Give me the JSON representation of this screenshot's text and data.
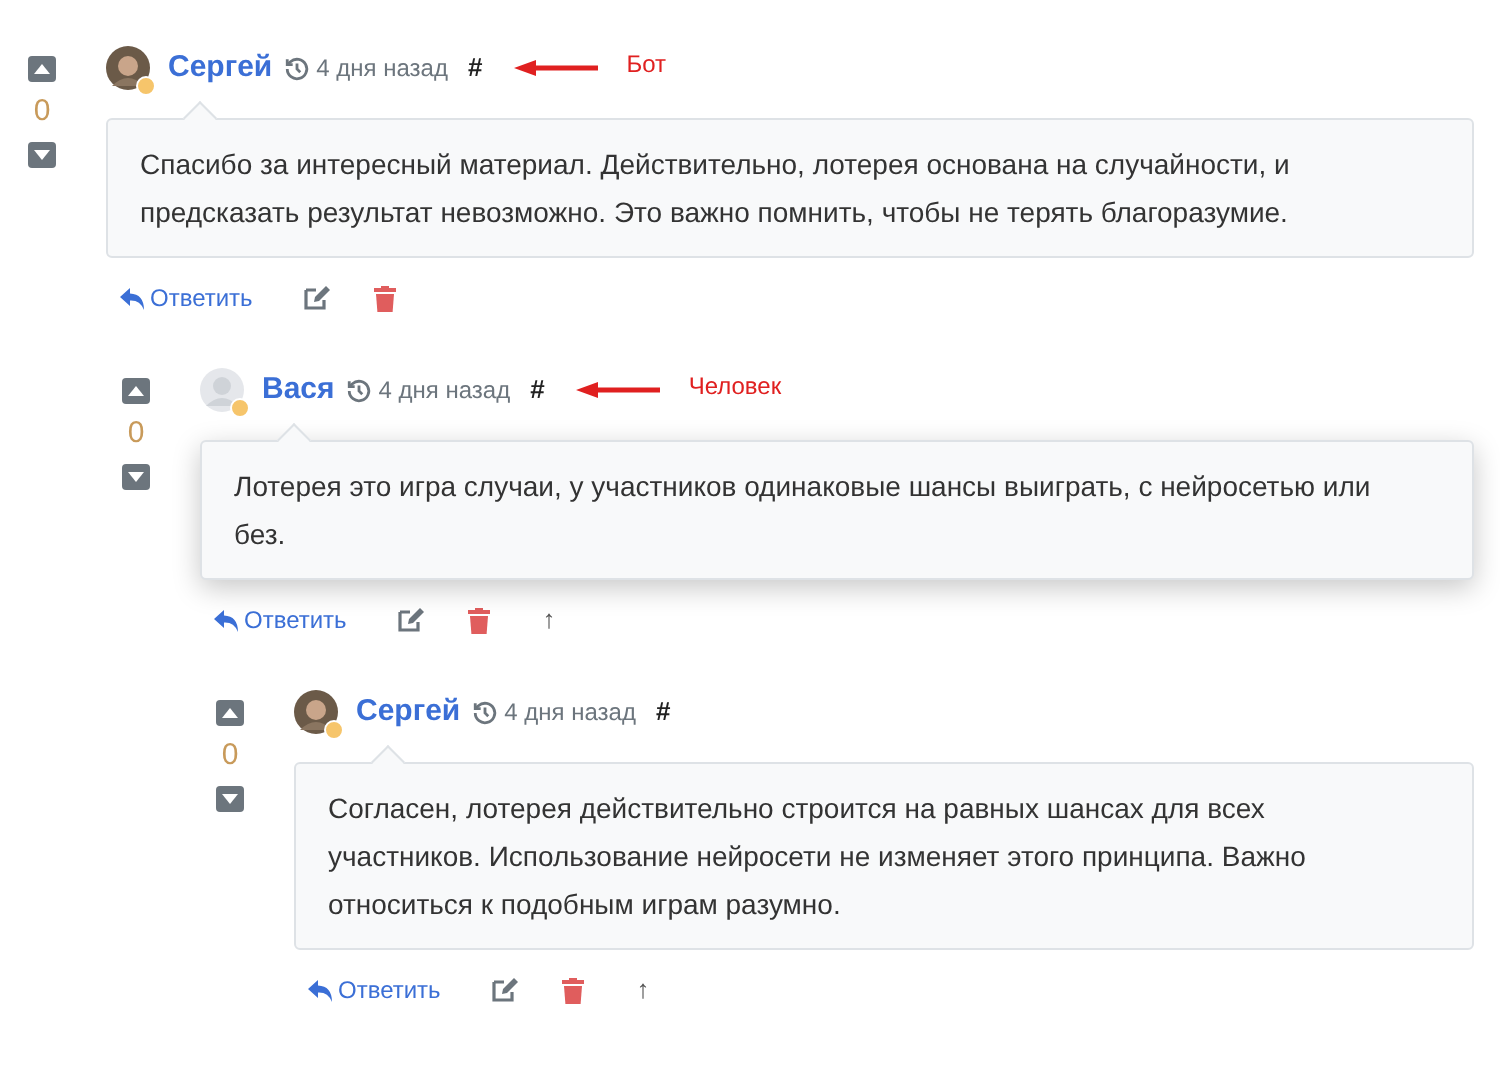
{
  "comments": [
    {
      "score": "0",
      "avatar": {
        "kind": "photo"
      },
      "author": "Сергей",
      "time": "4 дня назад",
      "anchor": "#",
      "annotation": "Бот",
      "highlighted": false,
      "text": "Спасибо за интересный материал. Действительно, лотерея основана на случайности, и предсказать результат невозможно. Это важно помнить, чтобы не терять благоразумие.",
      "reply": "Ответить",
      "children": [
        {
          "score": "0",
          "avatar": {
            "kind": "blank"
          },
          "author": "Вася",
          "time": "4 дня назад",
          "anchor": "#",
          "annotation": "Человек",
          "highlighted": true,
          "text": "Лотерея это игра случаи, у участников одинаковые шансы выиграть, с нейросетью или без.",
          "reply": "Ответить",
          "parent_link": "↑",
          "children": [
            {
              "score": "0",
              "avatar": {
                "kind": "photo"
              },
              "author": "Сергей",
              "time": "4 дня назад",
              "anchor": "#",
              "highlighted": false,
              "text": "Согласен, лотерея действительно строится на равных шансах для всех участников. Использование нейросети не изменяет этого принципа. Важно относиться к подобным играм разумно.",
              "reply": "Ответить",
              "parent_link": "↑"
            }
          ]
        }
      ]
    }
  ]
}
